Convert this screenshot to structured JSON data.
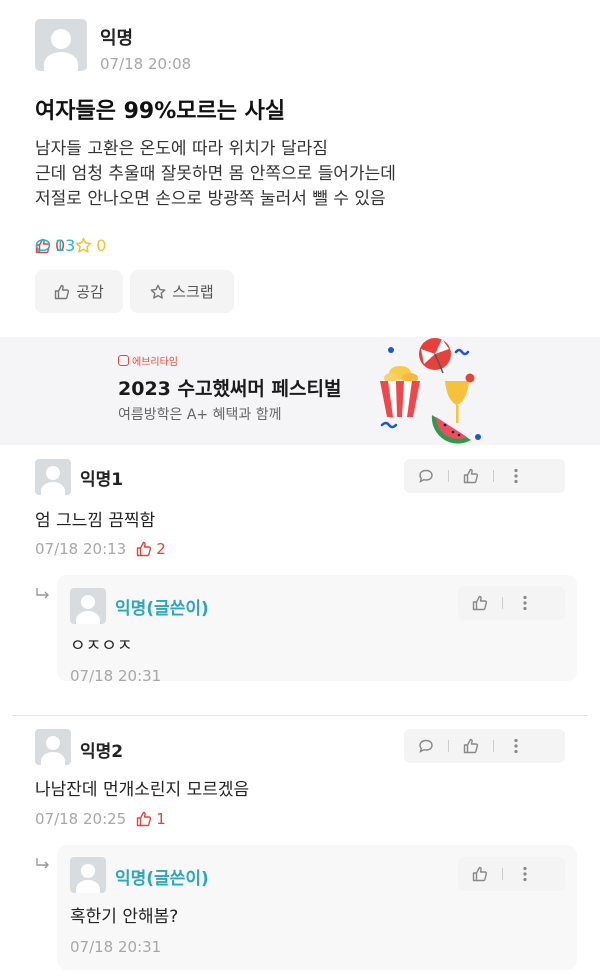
{
  "post": {
    "author": "익명",
    "time": "07/18 20:08",
    "title": "여자들은 99%모르는 사실",
    "body_lines": [
      "남자들 고환은 온도에 따라 위치가 달라짐",
      "근데 엄청 추울때 잘못하면 몸 안쪽으로 들어가는데",
      "저절로 안나오면 손으로 방광쪽 눌러서 뺄 수 있음"
    ],
    "like_count": "0",
    "comment_count": "13",
    "scrap_count": "0",
    "empathy_label": "공감",
    "scrap_label": "스크랩"
  },
  "ad": {
    "brand": "에브리타임",
    "title": "2023 수고했써머 페스티벌",
    "subtitle": "여름방학은 A+ 혜택과 함께"
  },
  "comments": [
    {
      "author": "익명1",
      "text": "엄 그느낌 끔찍함",
      "time": "07/18 20:13",
      "likes": "2",
      "reply": {
        "author": "익명(글쓴이)",
        "text": "ㅇㅈㅇㅈ",
        "time": "07/18 20:31"
      }
    },
    {
      "author": "익명2",
      "text": "나남잔데 먼개소린지 모르겠음",
      "time": "07/18 20:25",
      "likes": "1",
      "reply": {
        "author": "익명(글쓴이)",
        "text": "혹한기 안해봄?",
        "time": "07/18 20:31"
      }
    }
  ],
  "colors": {
    "like_red": "#e0453a",
    "comment_teal": "#2fb3c7",
    "scrap_yellow": "#f1c232",
    "author_teal": "#2ba6bd",
    "meta_gray": "#a7a7a7"
  },
  "icons": {
    "like": "thumbs-up-icon",
    "comment": "speech-bubble-icon",
    "scrap": "star-icon",
    "more": "vertical-dots-icon",
    "reply": "reply-arrow-icon"
  }
}
